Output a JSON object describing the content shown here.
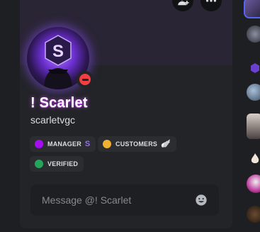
{
  "profile": {
    "display_name": "! Scarlet",
    "username": "scarletvgc",
    "status": "do-not-disturb",
    "status_color": "#f23f43",
    "avatar_glow": "#8c50ff"
  },
  "header_buttons": [
    {
      "icon": "add-friend-icon"
    },
    {
      "icon": "more-options-icon"
    }
  ],
  "roles": [
    {
      "label": "MANAGER",
      "color": "#a60df2",
      "badge": "S"
    },
    {
      "label": "CUSTOMERS",
      "color": "#f0b132",
      "badge": "🪽"
    },
    {
      "label": "VERIFIED",
      "color": "#23a55a",
      "badge": ""
    }
  ],
  "message": {
    "placeholder": "Message @! Scarlet",
    "emoji_icon": "emoji-smile-icon"
  },
  "colors": {
    "background": "#1e1f22",
    "card": "#232428",
    "accent": "#a060ff"
  }
}
